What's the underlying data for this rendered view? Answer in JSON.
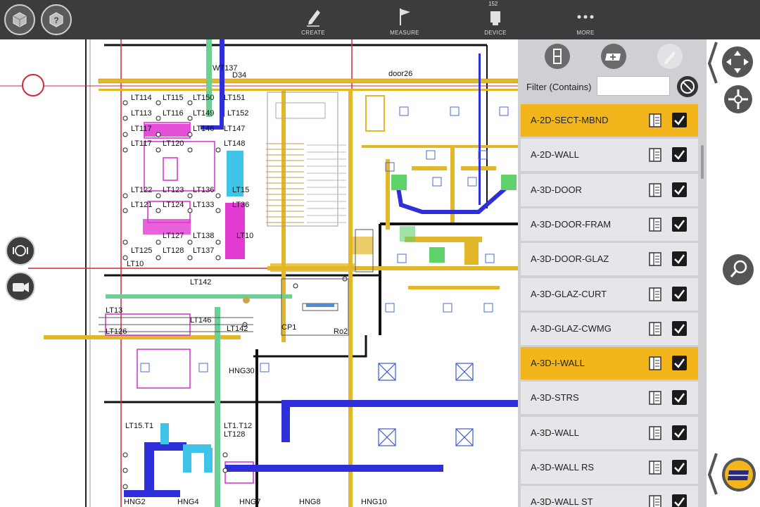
{
  "toolbar": {
    "create_label": "CREATE",
    "measure_label": "MEASURE",
    "device_label": "DEVICE",
    "device_badge": "152",
    "more_label": "MORE"
  },
  "top_left": {
    "icons": [
      "cube-view-icon",
      "help-icon"
    ]
  },
  "layers_panel": {
    "filter_label": "Filter (Contains)",
    "filter_value": "",
    "layers": [
      {
        "name": "A-2D-SECT-MBND",
        "selected": true,
        "checked": true
      },
      {
        "name": "A-2D-WALL",
        "selected": false,
        "checked": true
      },
      {
        "name": "A-3D-DOOR",
        "selected": false,
        "checked": true
      },
      {
        "name": "A-3D-DOOR-FRAM",
        "selected": false,
        "checked": true
      },
      {
        "name": "A-3D-DOOR-GLAZ",
        "selected": false,
        "checked": true
      },
      {
        "name": "A-3D-GLAZ-CURT",
        "selected": false,
        "checked": true
      },
      {
        "name": "A-3D-GLAZ-CWMG",
        "selected": false,
        "checked": true
      },
      {
        "name": "A-3D-I-WALL",
        "selected": true,
        "checked": true
      },
      {
        "name": "A-3D-STRS",
        "selected": false,
        "checked": true
      },
      {
        "name": "A-3D-WALL",
        "selected": false,
        "checked": true
      },
      {
        "name": "A-3D-WALL RS",
        "selected": false,
        "checked": true
      },
      {
        "name": "A-3D-WALL ST",
        "selected": false,
        "checked": true
      }
    ]
  },
  "drawing": {
    "labels": {
      "lt114": "LT114",
      "lt115": "LT115",
      "lt150": "LT150",
      "lt151": "LT151",
      "lt113": "LT113",
      "lt116": "LT116",
      "lt149": "LT149",
      "lt152": "LT152",
      "lt117": "LT117",
      "lt120": "LT120",
      "lt146": "LT146",
      "lt147": "LT147",
      "lt148": "LT148",
      "lt122": "LT122",
      "lt123": "LT123",
      "lt136": "LT136",
      "lt15": "LT15",
      "lt121": "LT121",
      "lt124": "LT124",
      "lt133": "LT133",
      "lt36": "LT36",
      "lt127": "LT127",
      "lt138": "LT138",
      "lt10": "LT10",
      "lt125": "LT125",
      "lt128": "LT128",
      "lt137": "LT137",
      "wt137": "WT137",
      "d34": "D34",
      "door26": "door26",
      "cp1": "CP1",
      "ro2": "Ro2",
      "hng30": "HNG30",
      "lt15t1": "LT15.T1",
      "lt112": "LT1.T12",
      "lt128b": "LT128",
      "hng2": "HNG2",
      "hng4": "HNG4",
      "hng7": "HNG7",
      "hng8": "HNG8",
      "hng10": "HNG10",
      "lt142": "LT142",
      "lt146b": "LT146",
      "lt126": "LT126",
      "lt10b": "LT10",
      "lt13": "LT13"
    }
  },
  "colors": {
    "topbar": "#3c3c3c",
    "selected_layer": "#f2b61c",
    "layer_row": "#e6e6ea",
    "panel_bg": "#cfcfd4"
  }
}
